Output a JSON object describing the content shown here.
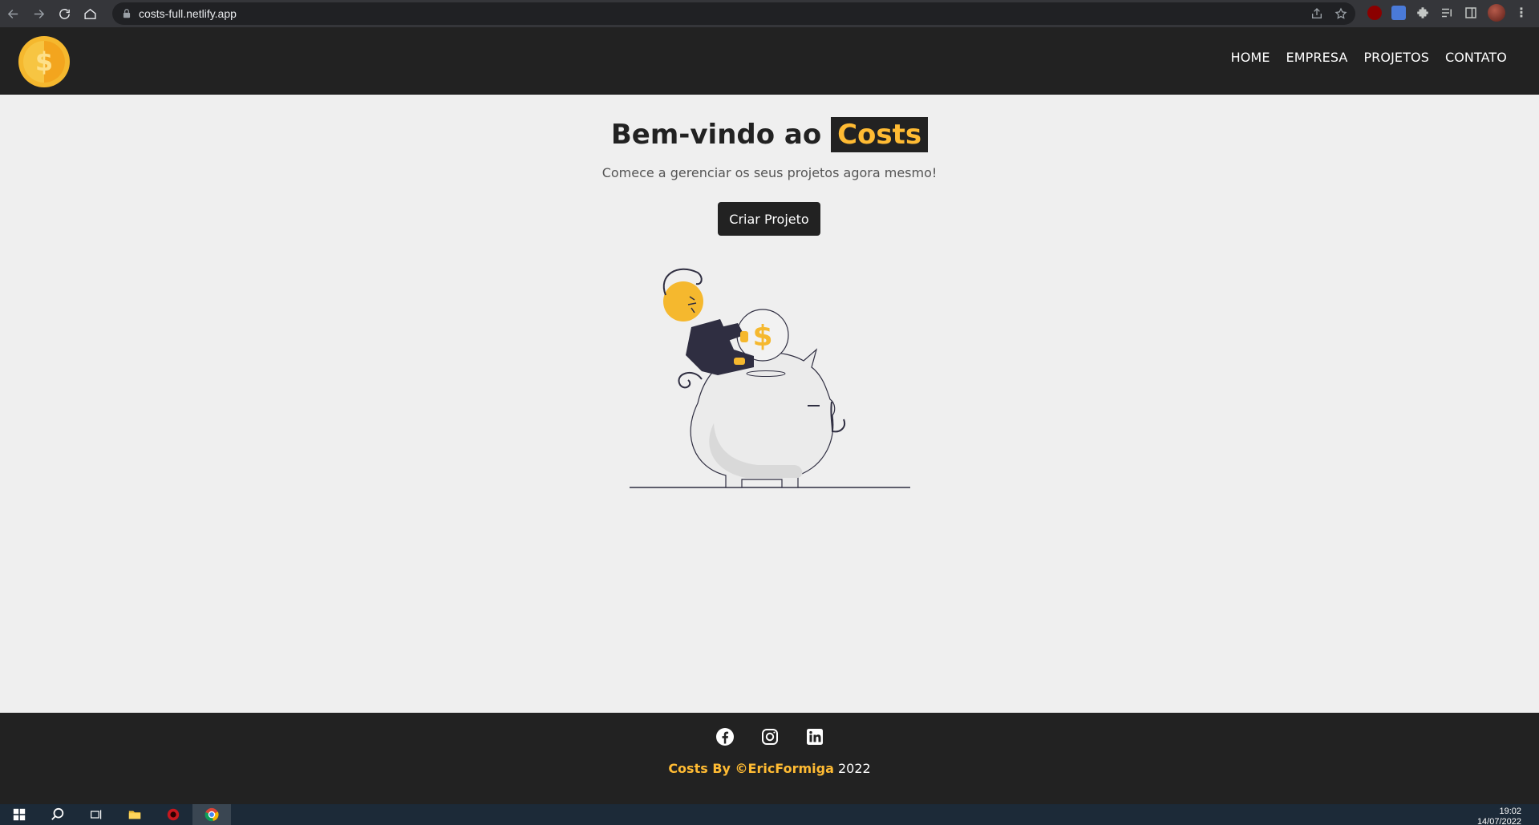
{
  "browser": {
    "url": "costs-full.netlify.app"
  },
  "navbar": {
    "logo_alt": "Costs",
    "links": [
      "HOME",
      "EMPRESA",
      "PROJETOS",
      "CONTATO"
    ]
  },
  "hero": {
    "title_prefix": "Bem-vindo ao",
    "title_brand": "Costs",
    "subtitle": "Comece a gerenciar os seus projetos agora mesmo!",
    "cta_label": "Criar Projeto"
  },
  "footer": {
    "social_icons": [
      "facebook-icon",
      "instagram-icon",
      "linkedin-icon"
    ],
    "copyright_brand": "Costs By ©EricFormiga",
    "copyright_year": "2022"
  },
  "taskbar": {
    "time": "19:02",
    "date": "14/07/2022"
  },
  "colors": {
    "dark": "#222222",
    "accent": "#ffbb33",
    "background": "#efefef"
  }
}
